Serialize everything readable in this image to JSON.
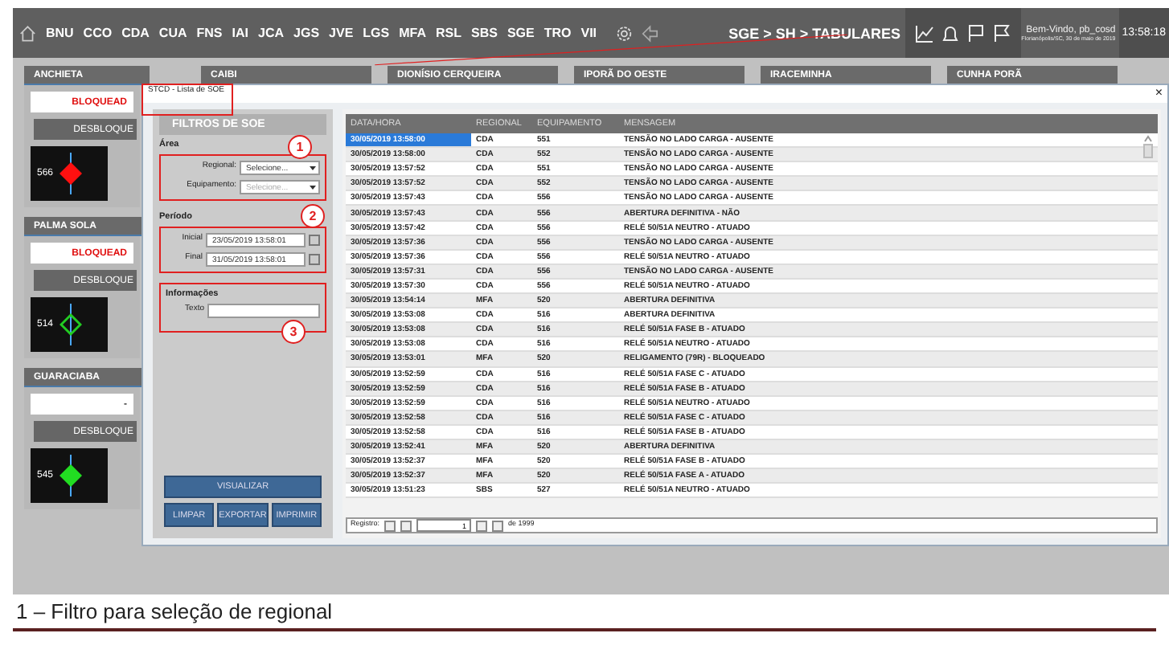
{
  "top_bar": {
    "regions": [
      "BNU",
      "CCO",
      "CDA",
      "CUA",
      "FNS",
      "IAI",
      "JCA",
      "JGS",
      "JVE",
      "LGS",
      "MFA",
      "RSL",
      "SBS",
      "SGE",
      "TRO",
      "VII"
    ],
    "breadcrumb": "SGE > SH > TABULARES",
    "welcome": "Bem-Vindo, pb_cosd",
    "location_date": "Florianópolis/SC, 30 de maio de 2019",
    "time": "13:58:18"
  },
  "dashboard": {
    "column_headers": [
      "CAIBI",
      "DIONÍSIO CERQUEIRA",
      "IPORÃ DO OESTE",
      "IRACEMINHA",
      "CUNHA PORÃ"
    ],
    "substations": [
      {
        "name": "ANCHIETA",
        "status": "BLOQUEAD",
        "alarm": true,
        "action": "DESBLOQUE",
        "tile": {
          "number": "566",
          "color": "#ff1010",
          "filled": true
        }
      },
      {
        "name": "PALMA SOLA",
        "status": "BLOQUEAD",
        "alarm": true,
        "action": "DESBLOQUE",
        "tile": {
          "number": "514",
          "color": "#22cc22",
          "filled": false
        }
      },
      {
        "name": "GUARACIABA",
        "status": "-",
        "alarm": false,
        "action": "DESBLOQUE",
        "tile": {
          "number": "545",
          "color": "#22dd22",
          "filled": true
        }
      }
    ]
  },
  "dialog": {
    "title": "STCD - Lista de SOE",
    "close": "×",
    "filters": {
      "header": "FILTROS DE SOE",
      "area": {
        "label": "Área",
        "regional_label": "Regional:",
        "regional_value": "Selecione...",
        "equipment_label": "Equipamento:",
        "equipment_value": "Selecione...",
        "equipment_disabled": true
      },
      "period": {
        "label": "Período",
        "start_label": "Inicial",
        "start": "23/05/2019 13:58:01",
        "end_label": "Final",
        "end": "31/05/2019 13:58:01"
      },
      "info": {
        "label": "Informações",
        "text_label": "Texto"
      },
      "buttons": [
        "VISUALIZAR",
        "LIMPAR",
        "EXPORTAR",
        "IMPRIMIR"
      ]
    },
    "table": {
      "columns": [
        "DATA/HORA",
        "REGIONAL",
        "EQUIPAMENTO",
        "MENSAGEM"
      ],
      "rows": [
        {
          "date": "30/05/2019 13:58:00",
          "regional": "CDA",
          "equipment": "551",
          "message": "TENSÃO NO LADO CARGA - AUSENTE",
          "selected": true
        },
        {
          "date": "30/05/2019 13:58:00",
          "regional": "CDA",
          "equipment": "552",
          "message": "TENSÃO NO LADO CARGA - AUSENTE",
          "selected": false
        },
        {
          "date": "30/05/2019 13:57:52",
          "regional": "CDA",
          "equipment": "551",
          "message": "TENSÃO NO LADO CARGA - AUSENTE",
          "selected": false
        },
        {
          "date": "30/05/2019 13:57:52",
          "regional": "CDA",
          "equipment": "552",
          "message": "TENSÃO NO LADO CARGA - AUSENTE",
          "selected": false
        },
        {
          "date": "30/05/2019 13:57:43",
          "regional": "CDA",
          "equipment": "556",
          "message": "TENSÃO NO LADO CARGA - AUSENTE",
          "selected": false
        },
        {
          "date": "30/05/2019 13:57:43",
          "regional": "CDA",
          "equipment": "556",
          "message": "ABERTURA DEFINITIVA - NÃO",
          "selected": false
        },
        {
          "date": "30/05/2019 13:57:42",
          "regional": "CDA",
          "equipment": "556",
          "message": "RELÉ 50/51A NEUTRO - ATUADO",
          "selected": false
        },
        {
          "date": "30/05/2019 13:57:36",
          "regional": "CDA",
          "equipment": "556",
          "message": "TENSÃO NO LADO CARGA - AUSENTE",
          "selected": false
        },
        {
          "date": "30/05/2019 13:57:36",
          "regional": "CDA",
          "equipment": "556",
          "message": "RELÉ 50/51A NEUTRO - ATUADO",
          "selected": false
        },
        {
          "date": "30/05/2019 13:57:31",
          "regional": "CDA",
          "equipment": "556",
          "message": "TENSÃO NO LADO CARGA - AUSENTE",
          "selected": false
        },
        {
          "date": "30/05/2019 13:57:30",
          "regional": "CDA",
          "equipment": "556",
          "message": "RELÉ 50/51A NEUTRO - ATUADO",
          "selected": false
        },
        {
          "date": "30/05/2019 13:54:14",
          "regional": "MFA",
          "equipment": "520",
          "message": "ABERTURA DEFINITIVA",
          "selected": false
        },
        {
          "date": "30/05/2019 13:53:08",
          "regional": "CDA",
          "equipment": "516",
          "message": "ABERTURA DEFINITIVA",
          "selected": false
        },
        {
          "date": "30/05/2019 13:53:08",
          "regional": "CDA",
          "equipment": "516",
          "message": "RELÉ 50/51A FASE B - ATUADO",
          "selected": false
        },
        {
          "date": "30/05/2019 13:53:08",
          "regional": "CDA",
          "equipment": "516",
          "message": "RELÉ 50/51A NEUTRO - ATUADO",
          "selected": false
        },
        {
          "date": "30/05/2019 13:53:01",
          "regional": "MFA",
          "equipment": "520",
          "message": "RELIGAMENTO (79R) - BLOQUEADO",
          "selected": false
        },
        {
          "date": "30/05/2019 13:52:59",
          "regional": "CDA",
          "equipment": "516",
          "message": "RELÉ 50/51A FASE C - ATUADO",
          "selected": false
        },
        {
          "date": "30/05/2019 13:52:59",
          "regional": "CDA",
          "equipment": "516",
          "message": "RELÉ 50/51A FASE B - ATUADO",
          "selected": false
        },
        {
          "date": "30/05/2019 13:52:59",
          "regional": "CDA",
          "equipment": "516",
          "message": "RELÉ 50/51A NEUTRO - ATUADO",
          "selected": false
        },
        {
          "date": "30/05/2019 13:52:58",
          "regional": "CDA",
          "equipment": "516",
          "message": "RELÉ 50/51A FASE C - ATUADO",
          "selected": false
        },
        {
          "date": "30/05/2019 13:52:58",
          "regional": "CDA",
          "equipment": "516",
          "message": "RELÉ 50/51A FASE B - ATUADO",
          "selected": false
        },
        {
          "date": "30/05/2019 13:52:41",
          "regional": "MFA",
          "equipment": "520",
          "message": "ABERTURA DEFINITIVA",
          "selected": false
        },
        {
          "date": "30/05/2019 13:52:37",
          "regional": "MFA",
          "equipment": "520",
          "message": "RELÉ 50/51A FASE B - ATUADO",
          "selected": false
        },
        {
          "date": "30/05/2019 13:52:37",
          "regional": "MFA",
          "equipment": "520",
          "message": "RELÉ 50/51A FASE A - ATUADO",
          "selected": false
        },
        {
          "date": "30/05/2019 13:51:23",
          "regional": "SBS",
          "equipment": "527",
          "message": "RELÉ 50/51A NEUTRO - ATUADO",
          "selected": false
        }
      ],
      "pager": {
        "label": "Registro:",
        "value": "1",
        "total": "de 1999"
      }
    }
  },
  "callouts": [
    "1",
    "2",
    "3"
  ],
  "caption": "1 – Filtro para seleção de regional"
}
